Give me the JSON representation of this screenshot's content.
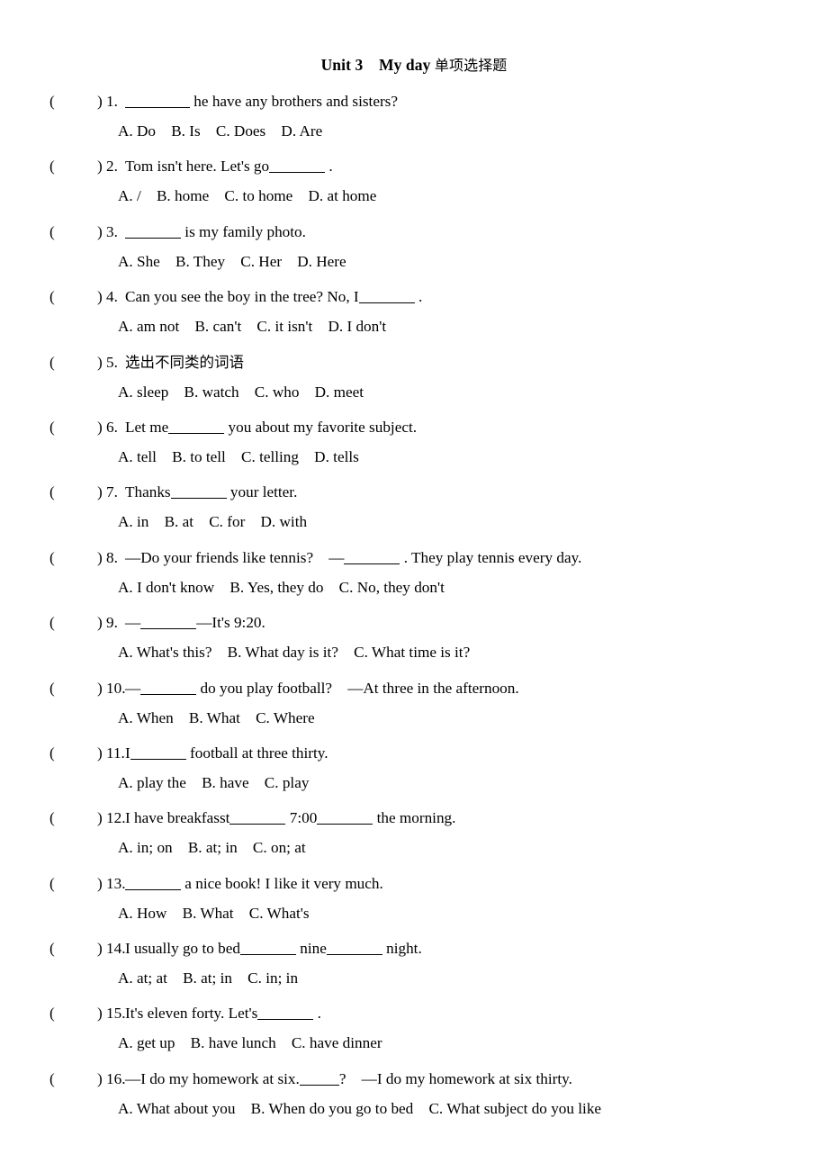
{
  "document": {
    "title_en": "Unit 3　My day ",
    "title_cjk": "单项选择题",
    "paren_open": "(",
    "paren_close": ")"
  },
  "questions": [
    {
      "number": "1.",
      "stem_before": "",
      "blank": "lg",
      "stem_after": " he have any brothers and sisters?",
      "options": "A. Do B. Is C. Does D. Are"
    },
    {
      "number": "2.",
      "stem_before": "Tom isn't here. Let's go",
      "blank": "md",
      "stem_after": " .",
      "options": "A. / B. home C. to home D. at home"
    },
    {
      "number": "3.",
      "stem_before": " ",
      "blank": "md",
      "stem_after": " is my family photo.",
      "options": "A. She B. They C. Her D. Here"
    },
    {
      "number": "4.",
      "stem_before": "Can you see the boy in the tree? No, I",
      "blank": "md",
      "stem_after": " .",
      "options": "A. am not B. can't C. it isn't D. I don't"
    },
    {
      "number": "5.",
      "stem_before": "",
      "blank": "none",
      "stem_after": "",
      "cjk_stem": "选出不同类的词语",
      "options": "A. sleep B. watch C. who D. meet"
    },
    {
      "number": "6.",
      "stem_before": "Let me",
      "blank": "md",
      "stem_after": " you about my favorite subject.",
      "options": "A. tell B. to tell C. telling D. tells"
    },
    {
      "number": "7.",
      "stem_before": "Thanks",
      "blank": "md",
      "stem_after": " your letter.",
      "options": "A. in B. at C. for D. with"
    },
    {
      "number": "8.",
      "stem_before": "—Do your friends like tennis? —",
      "blank": "md",
      "stem_after": " . They play tennis every day.",
      "options": "A. I don't know B. Yes, they do C. No, they don't"
    },
    {
      "number": "9.",
      "stem_before": "—",
      "blank": "md",
      "stem_after": "—It's 9:20.",
      "options": "A. What's this? B. What day is it? C. What time is it?"
    },
    {
      "number": "10.",
      "stem_before": "—",
      "blank": "md",
      "stem_after": " do you play football? —At three in the afternoon.",
      "options": "A. When B. What C. Where"
    },
    {
      "number": "11.",
      "stem_before": "I",
      "blank": "md",
      "stem_after": " football at three thirty.",
      "options": "A. play the B. have C. play"
    },
    {
      "number": "12.",
      "stem_before": "I have breakfasst",
      "blank": "md",
      "stem_after2": " 7:00",
      "blank2": "md",
      "stem_after": " the morning.",
      "options": "A. in; on B. at; in C. on; at"
    },
    {
      "number": "13.",
      "stem_before": " ",
      "blank": "md",
      "stem_after": " a nice book! I like it very much.",
      "options": "A. How B. What C. What's"
    },
    {
      "number": "14.",
      "stem_before": "I usually go to bed",
      "blank": "md",
      "stem_after2": " nine",
      "blank2": "md",
      "stem_after": " night.",
      "options": "A. at; at B. at; in C. in; in"
    },
    {
      "number": "15.",
      "stem_before": "It's eleven forty. Let's",
      "blank": "md",
      "stem_after": " .",
      "options": "A. get up B. have lunch C. have dinner"
    },
    {
      "number": "16.",
      "stem_before": "—I do my homework at six.",
      "blank": "sm",
      "stem_after": "? —I do my homework at six thirty.",
      "options": "A. What about you B. When do you go to bed C. What subject do you like"
    }
  ]
}
